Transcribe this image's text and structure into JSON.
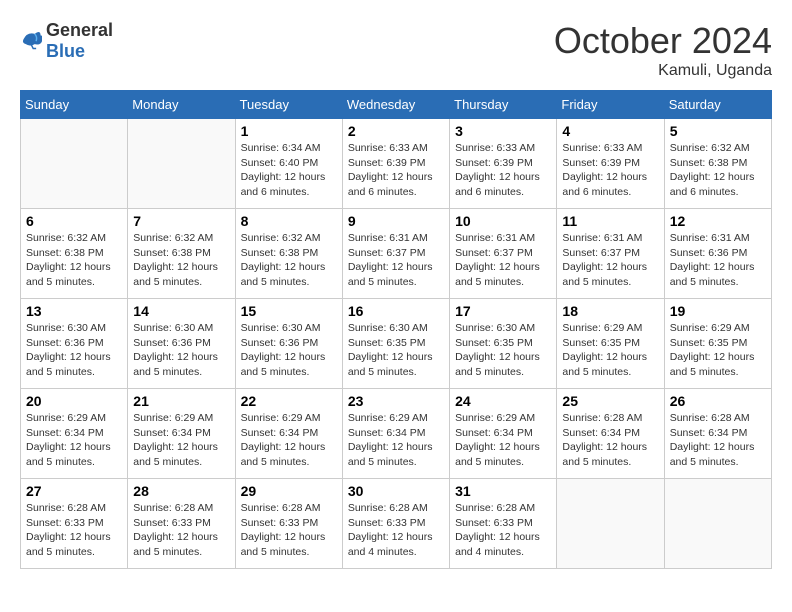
{
  "logo": {
    "general": "General",
    "blue": "Blue"
  },
  "title": {
    "month": "October 2024",
    "location": "Kamuli, Uganda"
  },
  "headers": [
    "Sunday",
    "Monday",
    "Tuesday",
    "Wednesday",
    "Thursday",
    "Friday",
    "Saturday"
  ],
  "weeks": [
    [
      {
        "day": "",
        "info": ""
      },
      {
        "day": "",
        "info": ""
      },
      {
        "day": "1",
        "sunrise": "6:34 AM",
        "sunset": "6:40 PM",
        "daylight": "12 hours and 6 minutes."
      },
      {
        "day": "2",
        "sunrise": "6:33 AM",
        "sunset": "6:39 PM",
        "daylight": "12 hours and 6 minutes."
      },
      {
        "day": "3",
        "sunrise": "6:33 AM",
        "sunset": "6:39 PM",
        "daylight": "12 hours and 6 minutes."
      },
      {
        "day": "4",
        "sunrise": "6:33 AM",
        "sunset": "6:39 PM",
        "daylight": "12 hours and 6 minutes."
      },
      {
        "day": "5",
        "sunrise": "6:32 AM",
        "sunset": "6:38 PM",
        "daylight": "12 hours and 6 minutes."
      }
    ],
    [
      {
        "day": "6",
        "sunrise": "6:32 AM",
        "sunset": "6:38 PM",
        "daylight": "12 hours and 5 minutes."
      },
      {
        "day": "7",
        "sunrise": "6:32 AM",
        "sunset": "6:38 PM",
        "daylight": "12 hours and 5 minutes."
      },
      {
        "day": "8",
        "sunrise": "6:32 AM",
        "sunset": "6:38 PM",
        "daylight": "12 hours and 5 minutes."
      },
      {
        "day": "9",
        "sunrise": "6:31 AM",
        "sunset": "6:37 PM",
        "daylight": "12 hours and 5 minutes."
      },
      {
        "day": "10",
        "sunrise": "6:31 AM",
        "sunset": "6:37 PM",
        "daylight": "12 hours and 5 minutes."
      },
      {
        "day": "11",
        "sunrise": "6:31 AM",
        "sunset": "6:37 PM",
        "daylight": "12 hours and 5 minutes."
      },
      {
        "day": "12",
        "sunrise": "6:31 AM",
        "sunset": "6:36 PM",
        "daylight": "12 hours and 5 minutes."
      }
    ],
    [
      {
        "day": "13",
        "sunrise": "6:30 AM",
        "sunset": "6:36 PM",
        "daylight": "12 hours and 5 minutes."
      },
      {
        "day": "14",
        "sunrise": "6:30 AM",
        "sunset": "6:36 PM",
        "daylight": "12 hours and 5 minutes."
      },
      {
        "day": "15",
        "sunrise": "6:30 AM",
        "sunset": "6:36 PM",
        "daylight": "12 hours and 5 minutes."
      },
      {
        "day": "16",
        "sunrise": "6:30 AM",
        "sunset": "6:35 PM",
        "daylight": "12 hours and 5 minutes."
      },
      {
        "day": "17",
        "sunrise": "6:30 AM",
        "sunset": "6:35 PM",
        "daylight": "12 hours and 5 minutes."
      },
      {
        "day": "18",
        "sunrise": "6:29 AM",
        "sunset": "6:35 PM",
        "daylight": "12 hours and 5 minutes."
      },
      {
        "day": "19",
        "sunrise": "6:29 AM",
        "sunset": "6:35 PM",
        "daylight": "12 hours and 5 minutes."
      }
    ],
    [
      {
        "day": "20",
        "sunrise": "6:29 AM",
        "sunset": "6:34 PM",
        "daylight": "12 hours and 5 minutes."
      },
      {
        "day": "21",
        "sunrise": "6:29 AM",
        "sunset": "6:34 PM",
        "daylight": "12 hours and 5 minutes."
      },
      {
        "day": "22",
        "sunrise": "6:29 AM",
        "sunset": "6:34 PM",
        "daylight": "12 hours and 5 minutes."
      },
      {
        "day": "23",
        "sunrise": "6:29 AM",
        "sunset": "6:34 PM",
        "daylight": "12 hours and 5 minutes."
      },
      {
        "day": "24",
        "sunrise": "6:29 AM",
        "sunset": "6:34 PM",
        "daylight": "12 hours and 5 minutes."
      },
      {
        "day": "25",
        "sunrise": "6:28 AM",
        "sunset": "6:34 PM",
        "daylight": "12 hours and 5 minutes."
      },
      {
        "day": "26",
        "sunrise": "6:28 AM",
        "sunset": "6:34 PM",
        "daylight": "12 hours and 5 minutes."
      }
    ],
    [
      {
        "day": "27",
        "sunrise": "6:28 AM",
        "sunset": "6:33 PM",
        "daylight": "12 hours and 5 minutes."
      },
      {
        "day": "28",
        "sunrise": "6:28 AM",
        "sunset": "6:33 PM",
        "daylight": "12 hours and 5 minutes."
      },
      {
        "day": "29",
        "sunrise": "6:28 AM",
        "sunset": "6:33 PM",
        "daylight": "12 hours and 5 minutes."
      },
      {
        "day": "30",
        "sunrise": "6:28 AM",
        "sunset": "6:33 PM",
        "daylight": "12 hours and 4 minutes."
      },
      {
        "day": "31",
        "sunrise": "6:28 AM",
        "sunset": "6:33 PM",
        "daylight": "12 hours and 4 minutes."
      },
      {
        "day": "",
        "info": ""
      },
      {
        "day": "",
        "info": ""
      }
    ]
  ],
  "labels": {
    "sunrise": "Sunrise:",
    "sunset": "Sunset:",
    "daylight": "Daylight:"
  }
}
